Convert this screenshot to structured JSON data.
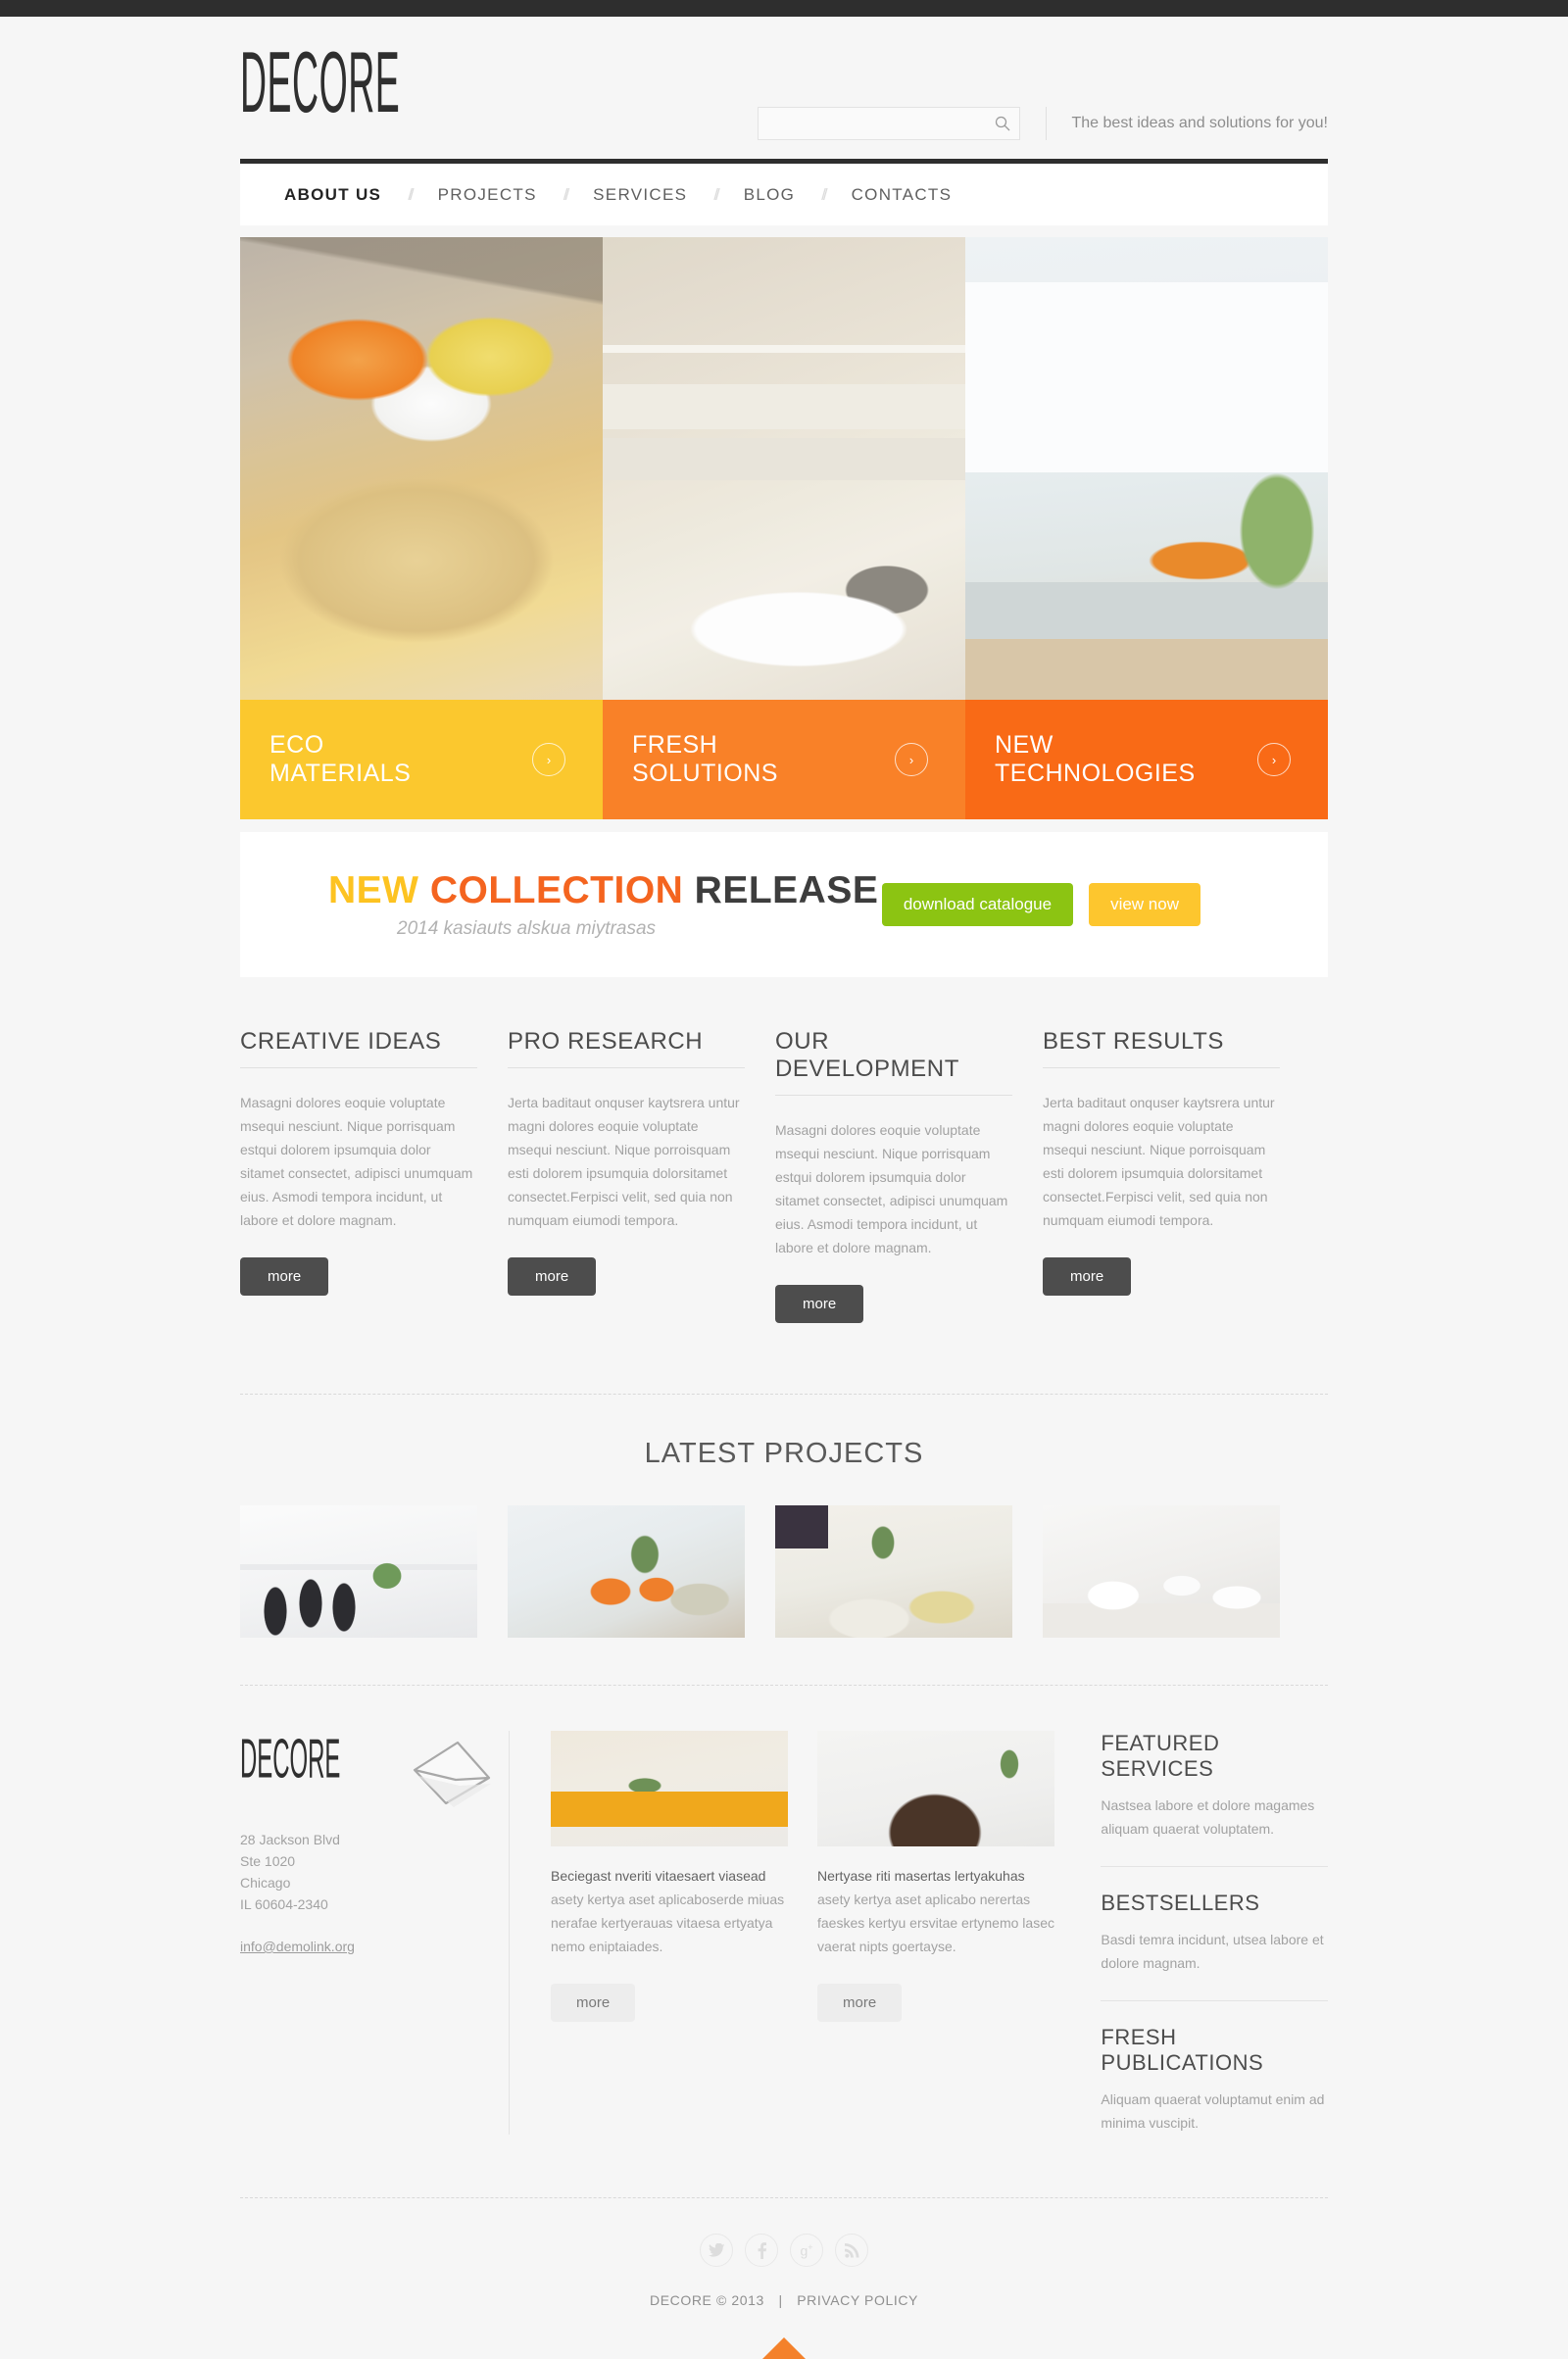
{
  "brand": {
    "name": "DECORE",
    "footer_name": "DECORE"
  },
  "search": {
    "value": "",
    "placeholder": "",
    "icon": "search-icon"
  },
  "tagline": "The best ideas and solutions for you!",
  "nav": {
    "separator": "//",
    "items": [
      {
        "label": "ABOUT US",
        "active": true
      },
      {
        "label": "PROJECTS",
        "active": false
      },
      {
        "label": "SERVICES",
        "active": false
      },
      {
        "label": "BLOG",
        "active": false
      },
      {
        "label": "CONTACTS",
        "active": false
      }
    ]
  },
  "hero": {
    "slides": [
      {
        "line1": "ECO",
        "line2": "MATERIALS",
        "color": "#fbc82e",
        "arrow": "chevron-right-icon"
      },
      {
        "line1": "FRESH",
        "line2": "SOLUTIONS",
        "color": "#f98128",
        "arrow": "chevron-right-icon"
      },
      {
        "line1": "NEW",
        "line2": "TECHNOLOGIES",
        "color": "#f96a16",
        "arrow": "chevron-right-icon"
      }
    ]
  },
  "promo": {
    "word1": "NEW",
    "word2": "COLLECTION",
    "word3": "RELEASE",
    "subtitle": "2014 kasiauts alskua miytrasas",
    "btn_download": "download catalogue",
    "btn_view": "view now",
    "color_word1": "#fdc321",
    "color_word2": "#f4641f",
    "color_word3": "#3d3d3d",
    "color_btn_download": "#8cc412",
    "color_btn_view": "#fdc62e"
  },
  "features": {
    "more_label": "more",
    "columns": [
      {
        "title": "CREATIVE IDEAS",
        "body": "Masagni dolores eoquie voluptate msequi nesciunt. Nique porrisquam estqui dolorem ipsumquia dolor sitamet consectet, adipisci unumquam eius. Asmodi tempora incidunt, ut labore et dolore magnam."
      },
      {
        "title": "PRO RESEARCH",
        "body": "Jerta baditaut onquser kaytsrera untur magni dolores eoquie voluptate msequi nesciunt. Nique porroisquam esti dolorem ipsumquia dolorsitamet consectet.Ferpisci velit, sed quia non numquam eiumodi tempora."
      },
      {
        "title": "OUR DEVELOPMENT",
        "body": "Masagni dolores eoquie voluptate msequi nesciunt. Nique porrisquam estqui dolorem ipsumquia dolor sitamet consectet, adipisci unumquam eius. Asmodi tempora incidunt, ut labore et dolore magnam."
      },
      {
        "title": "BEST RESULTS",
        "body": "Jerta baditaut onquser kaytsrera untur magni dolores eoquie voluptate msequi nesciunt. Nique porroisquam esti dolorem ipsumquia dolorsitamet consectet.Ferpisci velit, sed quia non numquam eiumodi tempora."
      }
    ]
  },
  "projects": {
    "title": "LATEST PROJECTS",
    "items": [
      {
        "alt": "white dining room project"
      },
      {
        "alt": "living room with orange pillows project"
      },
      {
        "alt": "bedroom with plants project"
      },
      {
        "alt": "white bathroom project"
      }
    ]
  },
  "footer": {
    "address_lines": [
      "28 Jackson Blvd",
      "Ste 1020",
      "Chicago",
      "IL 60604-2340"
    ],
    "email": "info@demolink.org",
    "envelope_icon": "envelope-icon",
    "posts": [
      {
        "lead": "Beciegast nveriti vitaesaert viasead",
        "body": "asety kertya aset aplicaboserde miuas nerafae kertyerauas vitaesa ertyatya nemo eniptaiades.",
        "more_label": "more"
      },
      {
        "lead": "Nertyase riti masertas lertyakuhas",
        "body": "asety kertya aset aplicabo nerertas faeskes kertyu ersvitae ertynemo lasec vaerat nipts goertayse.",
        "more_label": "more"
      }
    ],
    "blocks": [
      {
        "title": "FEATURED SERVICES",
        "body": "Nastsea labore et dolore magames aliquam quaerat voluptatem."
      },
      {
        "title": "BESTSELLERS",
        "body": "Basdi temra incidunt, utsea labore et dolore magnam."
      },
      {
        "title": "FRESH PUBLICATIONS",
        "body": "Aliquam quaerat voluptamut enim ad minima vuscipit."
      }
    ],
    "socials": [
      {
        "name": "twitter-icon",
        "glyph": "t"
      },
      {
        "name": "facebook-icon",
        "glyph": "f"
      },
      {
        "name": "google-plus-icon",
        "glyph": "g+"
      },
      {
        "name": "rss-icon",
        "glyph": "rss"
      }
    ],
    "copyright": "DECORE © 2013",
    "separator": "|",
    "privacy": "PRIVACY POLICY",
    "back_to_top": "back-to-top-icon"
  }
}
